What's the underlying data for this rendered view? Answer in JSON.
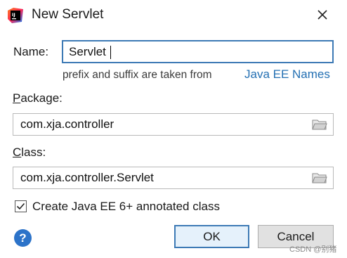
{
  "dialog": {
    "title": "New Servlet",
    "app_icon": "intellij-idea-icon",
    "close_icon": "close-icon"
  },
  "form": {
    "name_label": "Name:",
    "name_value": "Servlet",
    "hint_text": "prefix and suffix are taken from",
    "hint_link": "Java EE Names",
    "package_label_mnemonic": "P",
    "package_label_rest": "ackage:",
    "package_value": "com.xja.controller",
    "class_label_mnemonic": "C",
    "class_label_rest": "lass:",
    "class_value": "com.xja.controller.Servlet",
    "browse_icon": "folder-icon",
    "annotated_checkbox_label": "Create Java EE 6+ annotated class",
    "annotated_checked": true
  },
  "footer": {
    "help_label": "?",
    "ok_label": "OK",
    "cancel_label": "Cancel",
    "watermark": "CSDN @别猪"
  },
  "colors": {
    "accent": "#3d7ab5",
    "link": "#2470b3",
    "help": "#2c73c9"
  }
}
